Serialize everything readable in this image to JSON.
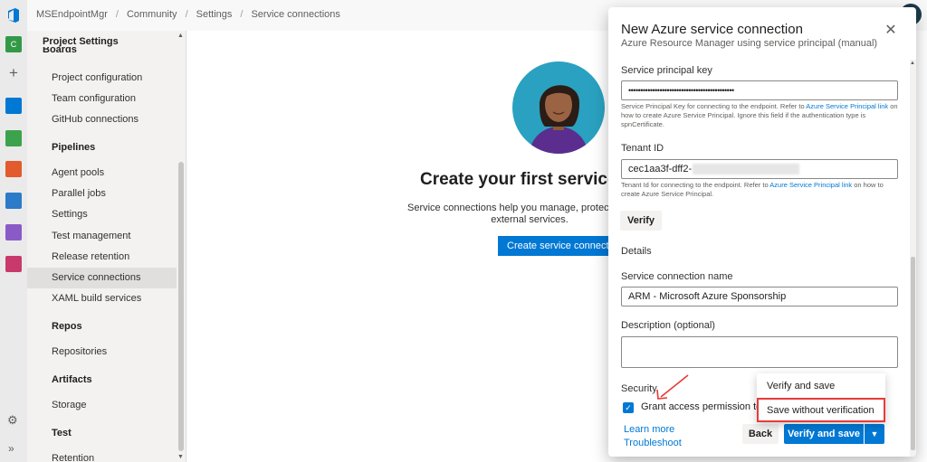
{
  "breadcrumb": [
    "MSEndpointMgr",
    "Community",
    "Settings",
    "Service connections"
  ],
  "nav": {
    "title": "Project Settings",
    "cut_heading": "Boards",
    "boards_items": [
      "Project configuration",
      "Team configuration",
      "GitHub connections"
    ],
    "pipelines_heading": "Pipelines",
    "pipelines_items": [
      "Agent pools",
      "Parallel jobs",
      "Settings",
      "Test management",
      "Release retention",
      "Service connections",
      "XAML build services"
    ],
    "repos_heading": "Repos",
    "repos_items": [
      "Repositories"
    ],
    "artifacts_heading": "Artifacts",
    "artifacts_items": [
      "Storage"
    ],
    "test_heading": "Test",
    "test_items": [
      "Retention"
    ],
    "selected": "Service connections"
  },
  "main": {
    "title": "Create your first service",
    "desc_line1": "Service connections help you manage, protect, an",
    "desc_line2": "external services.",
    "create_button": "Create service connectio"
  },
  "panel": {
    "title": "New Azure service connection",
    "subtitle": "Azure Resource Manager using service principal (manual)",
    "spk_label": "Service principal key",
    "spk_value": "••••••••••••••••••••••••••••••••••••••••••••",
    "spk_help_1": "Service Principal Key for connecting to the endpoint. Refer to ",
    "spk_help_link": "Azure Service Principal link",
    "spk_help_2": " on how to create Azure Service Principal. Ignore this field if the authentication type is spnCertificate.",
    "tenant_label": "Tenant ID",
    "tenant_value": "cec1aa3f-dff2-",
    "tenant_help_1": "Tenant Id for connecting to the endpoint. Refer to ",
    "tenant_help_link": "Azure Service Principal link",
    "tenant_help_2": " on how to create Azure Service Principal.",
    "verify_button": "Verify",
    "details_label": "Details",
    "name_label": "Service connection name",
    "name_value": "ARM - Microsoft Azure Sponsorship",
    "desc_label": "Description (optional)",
    "desc_value": "",
    "security_label": "Security",
    "grant_label": "Grant access permission to a",
    "grant_checked": true,
    "learn_more": "Learn more",
    "troubleshoot": "Troubleshoot",
    "back_button": "Back",
    "verify_save_button": "Verify and save",
    "menu_items": [
      "Verify and save",
      "Save without verification"
    ],
    "highlighted_menu_item": "Save without verification"
  },
  "colors": {
    "accent": "#0078d4",
    "highlight_box": "#e83a3a"
  },
  "icons": {
    "close": "close-icon",
    "dropdown": "chevron-down-icon",
    "settings": "gear-icon",
    "expand": "double-chevron-icon"
  }
}
